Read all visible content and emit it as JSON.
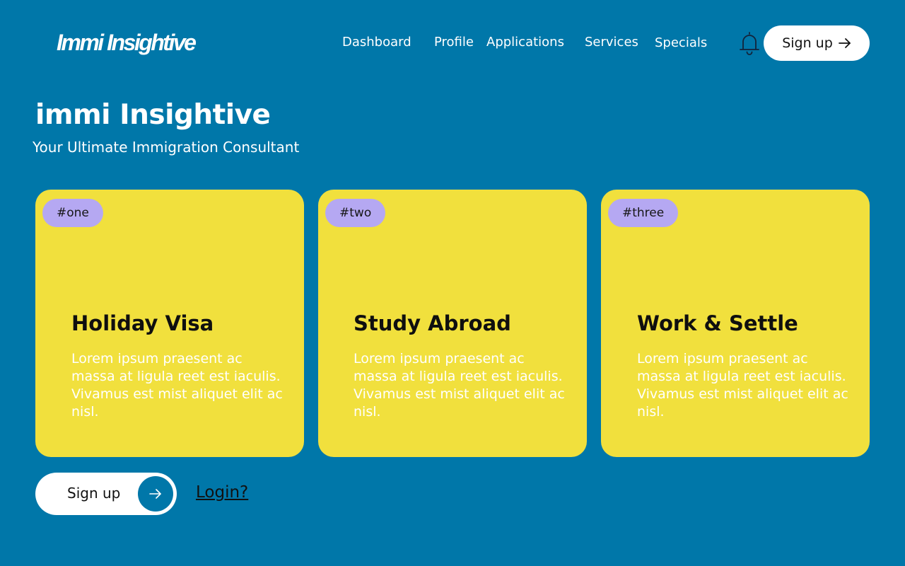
{
  "header": {
    "logo": "Immi Insightive",
    "nav": [
      "Dashboard",
      "Profile",
      "Applications",
      "Services",
      "Specials"
    ],
    "notification_icon": "bell-icon",
    "signup_label": "Sign up",
    "signup_icon": "arrow-right-icon"
  },
  "hero": {
    "title": "immi Insightive",
    "subtitle": "Your Ultimate Immigration Consultant"
  },
  "cards": [
    {
      "tag": "#one",
      "title": "Holiday Visa",
      "text": "Lorem ipsum praesent ac massa at ligula reet est iaculis. Vivamus est mist aliquet elit ac nisl."
    },
    {
      "tag": "#two",
      "title": "Study Abroad",
      "text": "Lorem ipsum praesent ac massa at ligula reet est iaculis. Vivamus est mist aliquet elit ac nisl."
    },
    {
      "tag": "#three",
      "title": "Work & Settle",
      "text": "Lorem ipsum praesent ac massa at ligula reet est iaculis. Vivamus est mist aliquet elit ac nisl."
    }
  ],
  "actions": {
    "signup_label": "Sign up",
    "signup_icon": "arrow-right-icon",
    "login_label": "Login?"
  },
  "colors": {
    "background": "#0077a9",
    "card": "#f1e03d",
    "tag": "#b5a8f2",
    "button": "#ffffff"
  }
}
